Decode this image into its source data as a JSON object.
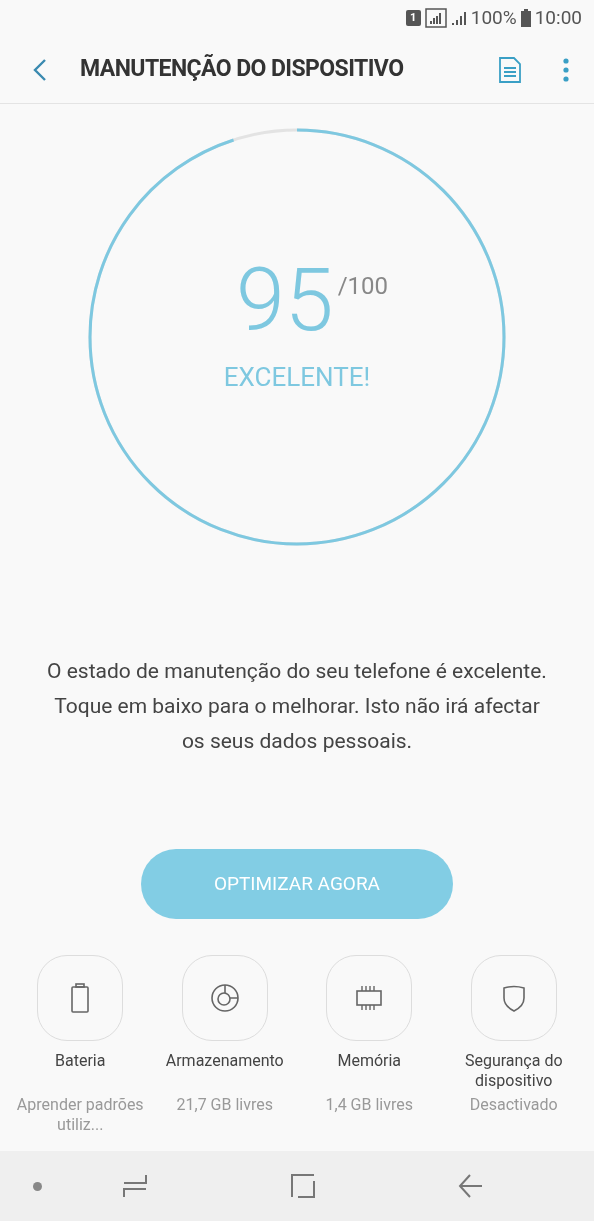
{
  "status_bar": {
    "sim": "1",
    "battery_text": "100%",
    "time": "10:00"
  },
  "header": {
    "title": "MANUTENÇÃO DO DISPOSITIVO"
  },
  "score": {
    "value": "95",
    "max": "/100",
    "rating": "EXCELENTE!",
    "level": 0.95
  },
  "description": "O estado de manutenção do seu telefone é excelente. Toque em baixo para o melhorar. Isto não irá afectar os seus dados pessoais.",
  "optimize_button": "OPTIMIZAR AGORA",
  "tiles": [
    {
      "kind": "battery",
      "label": "Bateria",
      "status": "Aprender padrões utiliz..."
    },
    {
      "kind": "storage",
      "label": "Armazenamento",
      "status": "21,7 GB livres"
    },
    {
      "kind": "memory",
      "label": "Memória",
      "status": "1,4 GB livres"
    },
    {
      "kind": "security",
      "label": "Segurança do dispositivo",
      "status": "Desactivado"
    }
  ]
}
